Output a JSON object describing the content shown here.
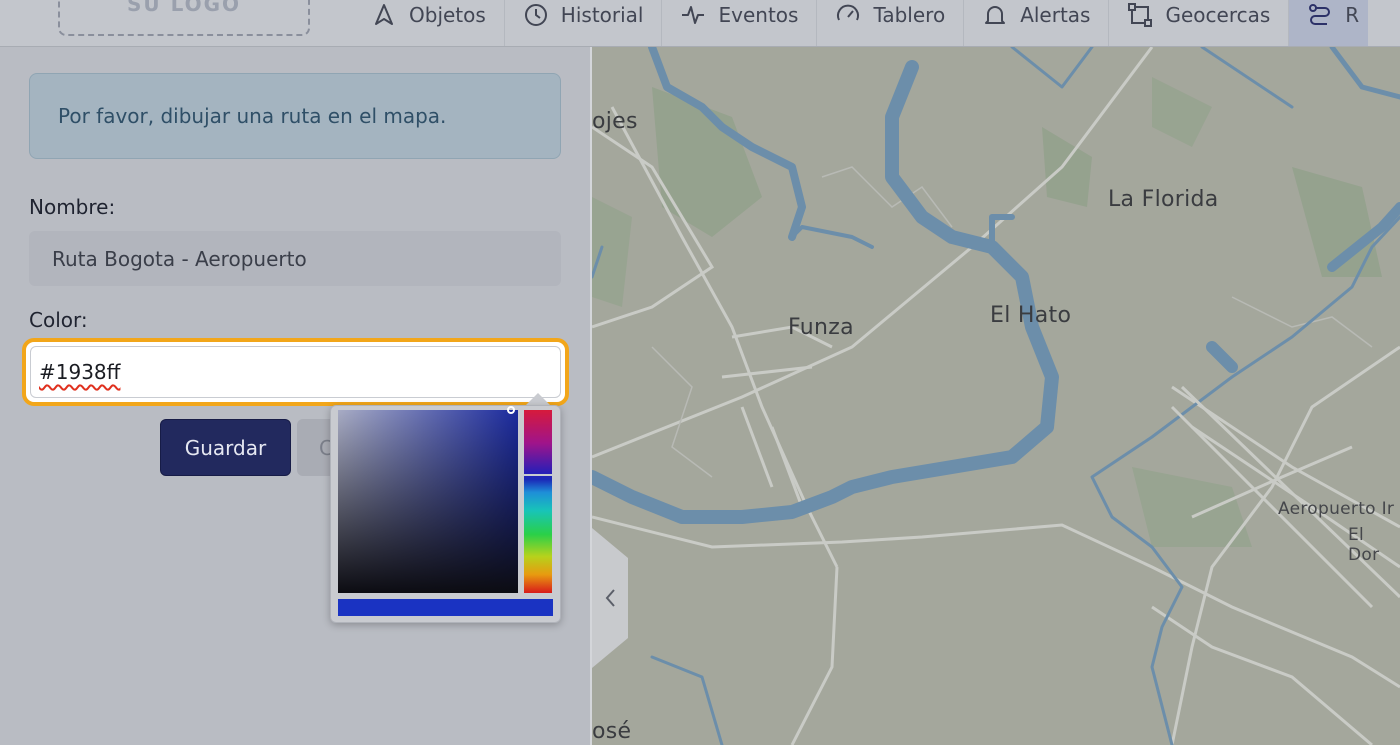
{
  "header": {
    "logo_text": "SU LOGO",
    "nav": [
      {
        "label": "Objetos",
        "icon": "navigation-arrow-icon"
      },
      {
        "label": "Historial",
        "icon": "clock-icon"
      },
      {
        "label": "Eventos",
        "icon": "pulse-icon"
      },
      {
        "label": "Tablero",
        "icon": "gauge-icon"
      },
      {
        "label": "Alertas",
        "icon": "bell-icon"
      },
      {
        "label": "Geocercas",
        "icon": "geofence-icon"
      },
      {
        "label": "R",
        "icon": "route-icon"
      }
    ]
  },
  "form": {
    "alert_text": "Por favor, dibujar una ruta en el mapa.",
    "name_label": "Nombre:",
    "name_value": "Ruta Bogota - Aeropuerto",
    "color_label": "Color:",
    "color_value": "#1938ff",
    "save_label": "Guardar",
    "cancel_label": "C"
  },
  "color_picker": {
    "selected_color": "#1938ff",
    "preview_color": "#1a33c2"
  },
  "map": {
    "labels": [
      "ojes",
      "La Florida",
      "Funza",
      "El Hato",
      "Aeropuerto Ir",
      "El Dor",
      "osé"
    ],
    "collapse_icon": "chevron-left-icon"
  }
}
